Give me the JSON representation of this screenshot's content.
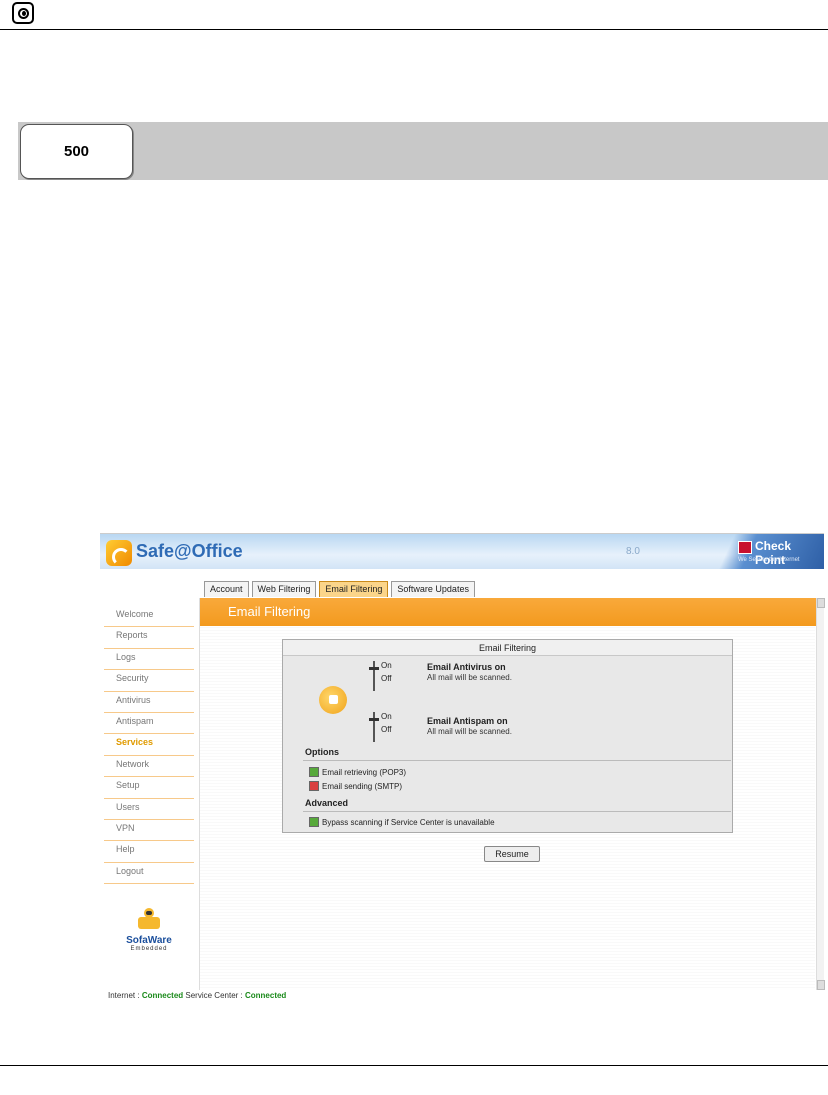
{
  "section": {
    "number": "500"
  },
  "app": {
    "title": "Safe@Office",
    "version": "8.0",
    "brand": {
      "name": "Check Point",
      "tagline": "We Secure the Internet"
    },
    "tabs": [
      {
        "label": "Account"
      },
      {
        "label": "Web Filtering"
      },
      {
        "label": "Email Filtering",
        "active": true
      },
      {
        "label": "Software Updates"
      }
    ],
    "sidebar": [
      {
        "label": "Welcome"
      },
      {
        "label": "Reports"
      },
      {
        "label": "Logs"
      },
      {
        "label": "Security"
      },
      {
        "label": "Antivirus"
      },
      {
        "label": "Antispam"
      },
      {
        "label": "Services",
        "active": true
      },
      {
        "label": "Network"
      },
      {
        "label": "Setup"
      },
      {
        "label": "Users"
      },
      {
        "label": "VPN"
      },
      {
        "label": "Help"
      },
      {
        "label": "Logout"
      }
    ],
    "vendor": {
      "name": "SofaWare",
      "sub": "Embedded"
    },
    "page_title": "Email Filtering",
    "panel": {
      "title": "Email Filtering",
      "antivirus": {
        "on": "On",
        "off": "Off",
        "title": "Email Antivirus on",
        "desc": "All mail will be scanned."
      },
      "antispam": {
        "on": "On",
        "off": "Off",
        "title": "Email Antispam on",
        "desc": "All mail will be scanned."
      },
      "options_label": "Options",
      "options": [
        {
          "label": "Email retrieving (POP3)",
          "state": "enabled"
        },
        {
          "label": "Email sending (SMTP)",
          "state": "disabled"
        }
      ],
      "advanced_label": "Advanced",
      "advanced": [
        {
          "label": "Bypass scanning if Service Center is unavailable",
          "state": "enabled"
        }
      ]
    },
    "resume_label": "Resume",
    "status": {
      "internet_label": "Internet :",
      "internet_value": "Connected",
      "service_label": "Service Center :",
      "service_value": "Connected"
    }
  },
  "colors": {
    "accent": "#f39a1e",
    "brand_blue": "#2f6bb5",
    "connected": "#1a8a1a"
  }
}
